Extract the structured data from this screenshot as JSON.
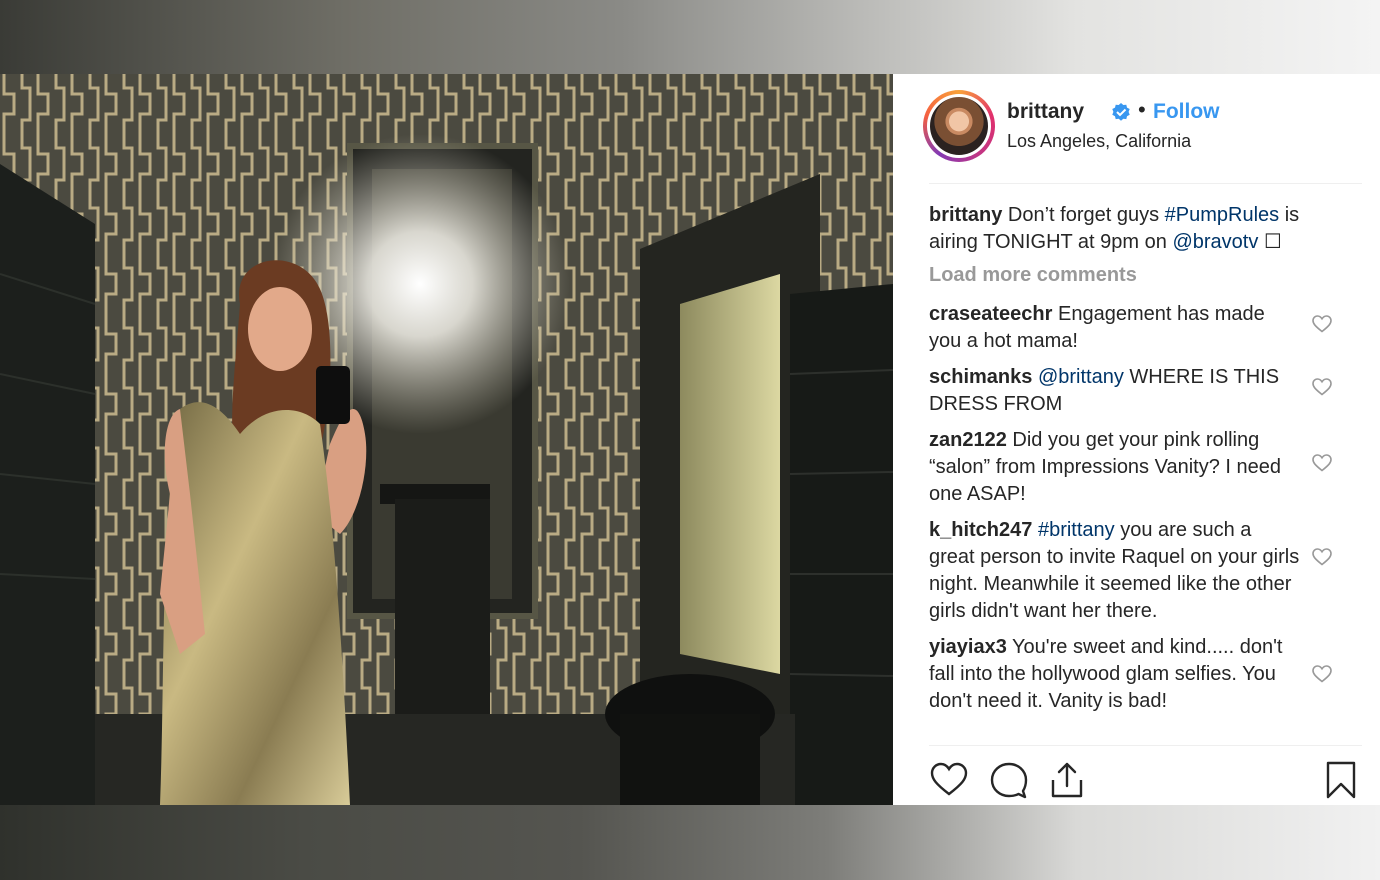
{
  "post": {
    "username": "brittany",
    "follow_label": "Follow",
    "separator": "•",
    "location": "Los Angeles, California"
  },
  "caption": {
    "user": "brittany",
    "text_1": " Don’t forget guys ",
    "hashtag": "#PumpRules",
    "text_2": " is airing TONIGHT at 9pm on ",
    "mention": "@bravotv",
    "trailing": " ☐"
  },
  "load_more_label": "Load more comments",
  "comments": [
    {
      "user": "craseateechr",
      "text": " Engagement has made you a hot mama!"
    },
    {
      "user": "schimanks",
      "mention": "@brittany",
      "text": " WHERE IS THIS DRESS FROM"
    },
    {
      "user": "zan2122",
      "text": " Did you get your pink rolling “salon” from Impressions Vanity? I need one ASAP!"
    },
    {
      "user": "k_hitch247",
      "mention": "#brittany",
      "text": " you are such a great person to invite Raquel on your girls night. Meanwhile it seemed like the other girls didn't want her there."
    },
    {
      "user": "yiayiax3",
      "text": " You're sweet and kind..... don't fall into the hollywood glam selfies. You don't need it. Vanity is bad!"
    }
  ],
  "icons": {
    "like": "heart-icon",
    "comment": "comment-bubble-icon",
    "share": "share-icon",
    "save": "bookmark-icon",
    "verified": "verified-badge-icon"
  },
  "colors": {
    "link": "#003569",
    "follow": "#3897f0",
    "muted": "#999999",
    "text": "#262626"
  }
}
